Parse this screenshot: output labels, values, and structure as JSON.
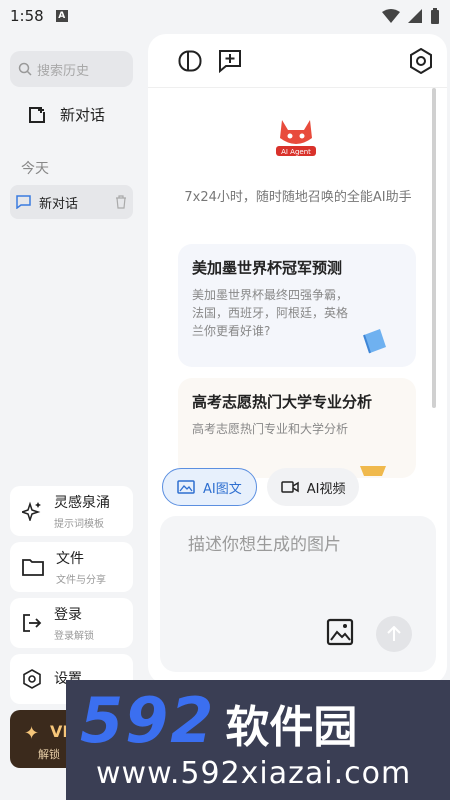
{
  "status_bar": {
    "time": "1:58",
    "notif_letter": "A"
  },
  "sidebar": {
    "search_placeholder": "搜索历史",
    "new_chat": "新对话",
    "section_today": "今天",
    "history": [
      {
        "label": "新对话"
      }
    ],
    "menu": [
      {
        "title": "灵感泉涌",
        "sub": "提示词模板",
        "icon": "sparkle-icon"
      },
      {
        "title": "文件",
        "sub": "文件与分享",
        "icon": "folder-icon"
      },
      {
        "title": "登录",
        "sub": "登录解锁",
        "icon": "login-icon"
      },
      {
        "title": "设置",
        "sub": "",
        "icon": "gear-icon"
      }
    ],
    "vip": {
      "label": "VI",
      "sub": "解锁"
    }
  },
  "main": {
    "logo_text": "AI Agent",
    "tagline": "7x24小时，随时随地召唤的全能AI助手",
    "cards": [
      {
        "title": "美加墨世界杯冠军预测",
        "desc": "美加墨世界杯最终四强争霸，法国，西班牙，阿根廷，英格兰你更看好谁?"
      },
      {
        "title": "高考志愿热门大学专业分析",
        "desc": "高考志愿热门专业和大学分析"
      }
    ],
    "modes": [
      {
        "label": "AI图文",
        "active": true
      },
      {
        "label": "AI视频",
        "active": false
      }
    ],
    "input_placeholder": "描述你想生成的图片"
  },
  "watermark": {
    "num": "592",
    "cn": "软件园",
    "url": "www.592xiazai.com"
  },
  "colors": {
    "accent": "#2e6fd0",
    "watermark_bg": "#3a3e54",
    "watermark_blue": "#3b6ff0",
    "vip_bg": "#3b2a1c"
  }
}
